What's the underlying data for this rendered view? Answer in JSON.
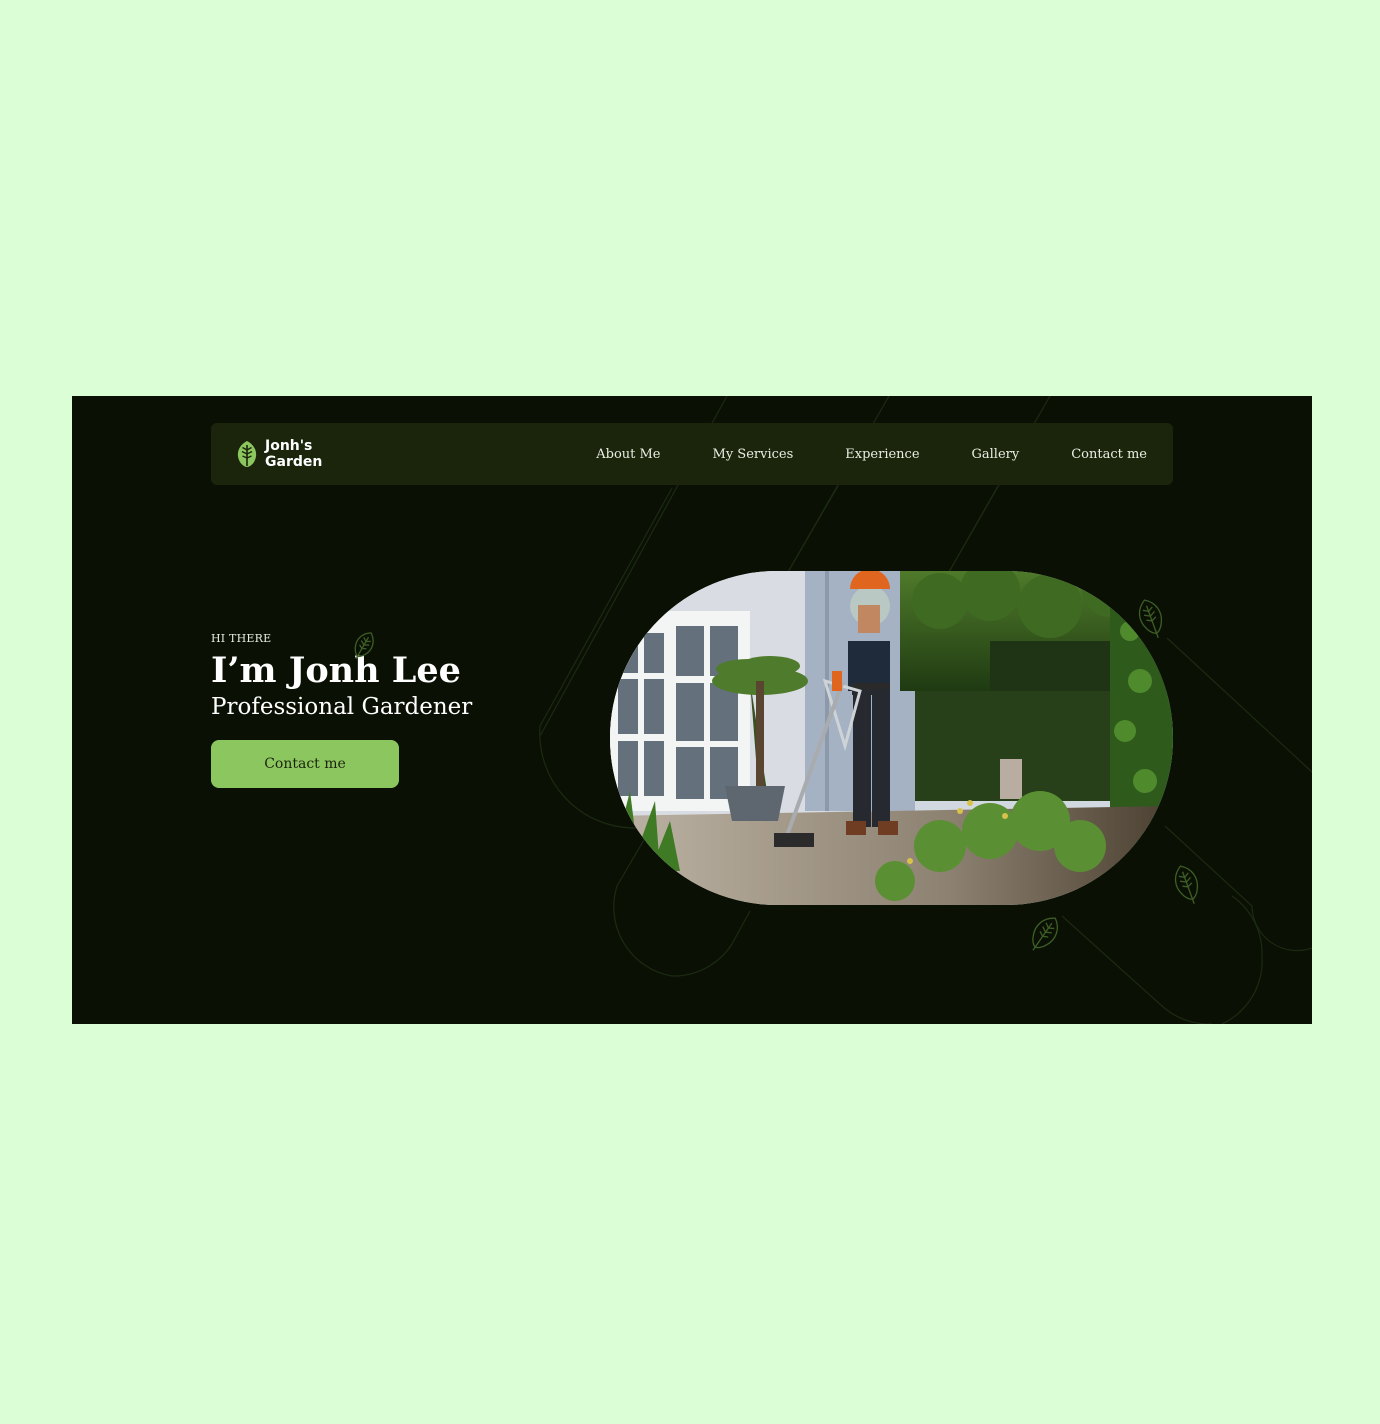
{
  "brand": {
    "name_line1": "Jonh's",
    "name_line2": "Garden"
  },
  "nav": {
    "items": [
      {
        "label": "About Me"
      },
      {
        "label": "My Services"
      },
      {
        "label": "Experience"
      },
      {
        "label": "Gallery"
      },
      {
        "label": "Contact me"
      }
    ]
  },
  "hero": {
    "eyebrow": "HI THERE",
    "headline": "I’m Jonh Lee",
    "subtitle": "Professional Gardener",
    "cta_label": "Contact me"
  },
  "colors": {
    "page_background": "#dbfed7",
    "site_background": "#0a1104",
    "navbar_background": "#1a250c",
    "accent": "#8cc65e",
    "text": "#ffffff"
  },
  "icons": {
    "logo": "leaf-icon",
    "decoration": "leaf-outline-icon"
  },
  "images": {
    "hero_photo": "gardener trimming grass in a garden beside a house"
  }
}
